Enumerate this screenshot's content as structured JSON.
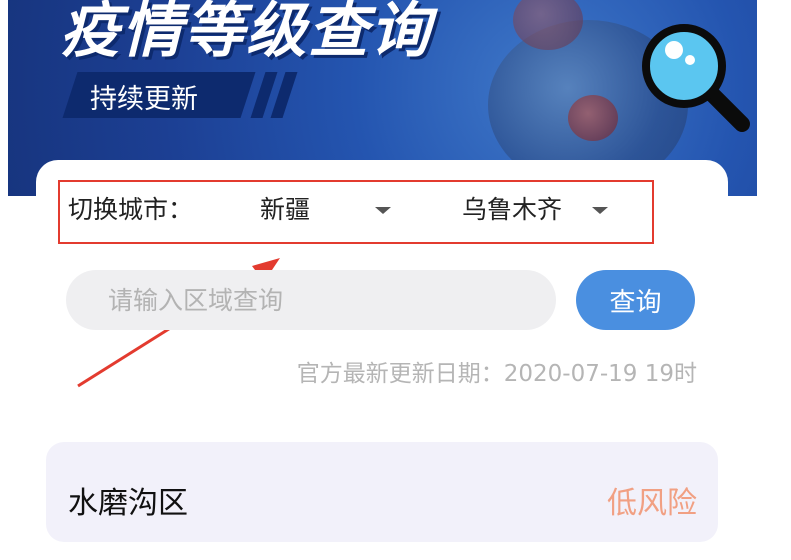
{
  "banner": {
    "title": "疫情等级查询",
    "subtitle": "持续更新"
  },
  "selector": {
    "label": "切换城市：",
    "province": "新疆",
    "city": "乌鲁木齐"
  },
  "search": {
    "placeholder": "请输入区域查询",
    "value": "",
    "button_label": "查询"
  },
  "update_info": "官方最新更新日期：2020-07-19 19时",
  "results": [
    {
      "district": "水磨沟区",
      "risk": "低风险"
    }
  ],
  "colors": {
    "banner": "#1c3f93",
    "highlight_border": "#e33b2f",
    "button": "#4a8fe0",
    "risk_low": "#f1a083",
    "input_bg": "#efeff1",
    "result_bg": "#f2f1fa"
  },
  "icons": [
    "virus-illustration",
    "magnifier-icon",
    "dropdown-caret-icon",
    "annotation-arrow"
  ]
}
